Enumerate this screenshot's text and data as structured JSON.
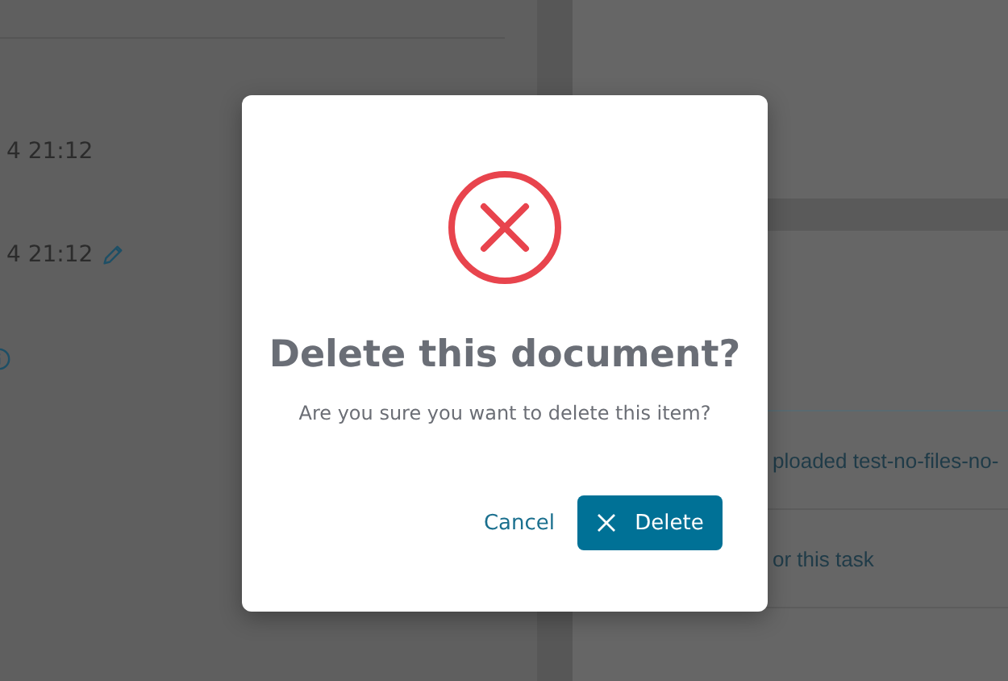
{
  "left_panel": {
    "rows": [
      {
        "text": "4 21:12",
        "editable": false
      },
      {
        "text": "4 21:12",
        "editable": true
      }
    ]
  },
  "right_panel": {
    "rows": [
      {
        "text": "ploaded test-no-files-no-"
      },
      {
        "text": "or this task"
      }
    ]
  },
  "dialog": {
    "title": "Delete this document?",
    "message": "Are you sure you want to delete this item?",
    "buttons": [
      {
        "label": "Cancel",
        "kind": "link"
      },
      {
        "label": "Delete",
        "kind": "primary"
      }
    ]
  }
}
